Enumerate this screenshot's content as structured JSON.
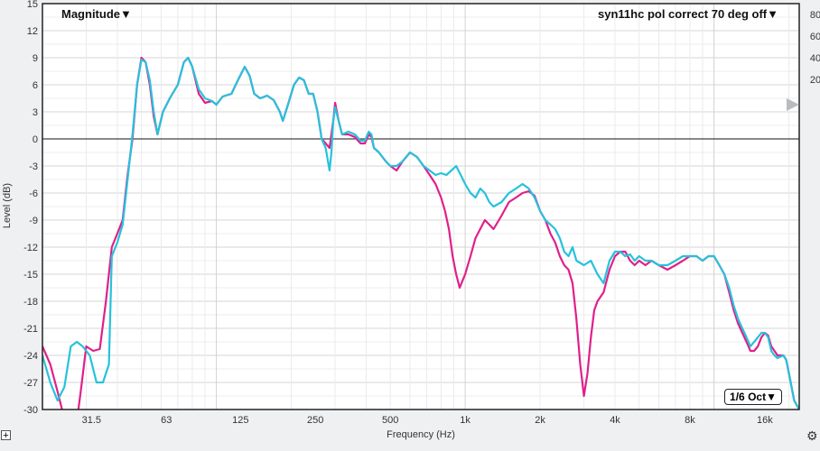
{
  "header": {
    "dropdown_label": "Magnitude▼",
    "title": "syn11hc pol correct 70 deg off▼"
  },
  "smoothing": {
    "label": "1/6 Oct▼"
  },
  "controls": {
    "expand_glyph": "+",
    "settings_glyph": "⚙"
  },
  "chart_data": {
    "type": "line",
    "title": "syn11hc pol correct 70 deg off",
    "xlabel": "Frequency (Hz)",
    "ylabel": "Level (dB)",
    "x_scale": "log",
    "xlim": [
      20,
      22000
    ],
    "ylim": [
      -30,
      15
    ],
    "grid": true,
    "x_ticks": [
      {
        "v": 31.5,
        "label": "31.5"
      },
      {
        "v": 63,
        "label": "63"
      },
      {
        "v": 125,
        "label": "125"
      },
      {
        "v": 250,
        "label": "250"
      },
      {
        "v": 500,
        "label": "500"
      },
      {
        "v": 1000,
        "label": "1k"
      },
      {
        "v": 2000,
        "label": "2k"
      },
      {
        "v": 4000,
        "label": "4k"
      },
      {
        "v": 8000,
        "label": "8k"
      },
      {
        "v": 16000,
        "label": "16k"
      }
    ],
    "y_ticks": [
      15,
      12,
      9,
      6,
      3,
      0,
      -3,
      -6,
      -9,
      -12,
      -15,
      -18,
      -21,
      -24,
      -27,
      -30
    ],
    "right_axis": {
      "ticks": [
        80,
        60,
        40,
        20
      ],
      "tick_levels_db": [
        13.8,
        11.4,
        9.0,
        6.6
      ]
    },
    "colors": {
      "magenta": "#e0208a",
      "cyan": "#26c2dc"
    },
    "series": [
      {
        "color": "magenta",
        "points": [
          [
            20,
            -23
          ],
          [
            21.5,
            -25
          ],
          [
            23,
            -28
          ],
          [
            25,
            -32
          ],
          [
            27,
            -34
          ],
          [
            28.5,
            -28
          ],
          [
            30,
            -23
          ],
          [
            32,
            -23.5
          ],
          [
            34,
            -23.3
          ],
          [
            36,
            -18
          ],
          [
            38,
            -12
          ],
          [
            40,
            -10.5
          ],
          [
            42,
            -9
          ],
          [
            44,
            -4
          ],
          [
            46,
            0
          ],
          [
            48,
            6
          ],
          [
            50,
            9
          ],
          [
            52,
            8.5
          ],
          [
            54,
            6
          ],
          [
            56,
            2.5
          ],
          [
            58,
            0.5
          ],
          [
            61,
            3
          ],
          [
            65,
            4.5
          ],
          [
            70,
            6
          ],
          [
            74,
            8.5
          ],
          [
            77,
            9
          ],
          [
            80,
            8
          ],
          [
            85,
            5
          ],
          [
            90,
            4
          ],
          [
            96,
            4.2
          ],
          [
            100,
            3.8
          ],
          [
            106,
            4.7
          ],
          [
            115,
            5
          ],
          [
            122,
            6.5
          ],
          [
            130,
            8
          ],
          [
            136,
            7
          ],
          [
            142,
            5
          ],
          [
            150,
            4.5
          ],
          [
            160,
            4.8
          ],
          [
            170,
            4.3
          ],
          [
            180,
            3
          ],
          [
            185,
            2
          ],
          [
            195,
            4
          ],
          [
            205,
            6
          ],
          [
            215,
            6.8
          ],
          [
            225,
            6.5
          ],
          [
            235,
            5
          ],
          [
            245,
            5
          ],
          [
            255,
            3
          ],
          [
            265,
            0
          ],
          [
            275,
            -0.5
          ],
          [
            285,
            -1
          ],
          [
            295,
            2
          ],
          [
            300,
            4
          ],
          [
            310,
            2
          ],
          [
            320,
            0.5
          ],
          [
            340,
            0.5
          ],
          [
            360,
            0.2
          ],
          [
            380,
            -0.5
          ],
          [
            395,
            -0.5
          ],
          [
            410,
            0.5
          ],
          [
            420,
            0.2
          ],
          [
            430,
            -1
          ],
          [
            450,
            -1.5
          ],
          [
            480,
            -2.5
          ],
          [
            500,
            -3
          ],
          [
            530,
            -3.5
          ],
          [
            560,
            -2.5
          ],
          [
            600,
            -1.5
          ],
          [
            640,
            -2
          ],
          [
            680,
            -3
          ],
          [
            720,
            -4
          ],
          [
            760,
            -5
          ],
          [
            800,
            -6.5
          ],
          [
            830,
            -8
          ],
          [
            860,
            -10
          ],
          [
            890,
            -13
          ],
          [
            920,
            -15
          ],
          [
            950,
            -16.5
          ],
          [
            1000,
            -15
          ],
          [
            1050,
            -13
          ],
          [
            1100,
            -11
          ],
          [
            1200,
            -9
          ],
          [
            1250,
            -9.5
          ],
          [
            1300,
            -10
          ],
          [
            1400,
            -8.5
          ],
          [
            1500,
            -7
          ],
          [
            1600,
            -6.5
          ],
          [
            1700,
            -6
          ],
          [
            1800,
            -5.8
          ],
          [
            1900,
            -6.3
          ],
          [
            2000,
            -8
          ],
          [
            2100,
            -9
          ],
          [
            2200,
            -10.5
          ],
          [
            2300,
            -11.5
          ],
          [
            2400,
            -13
          ],
          [
            2500,
            -14
          ],
          [
            2600,
            -14.5
          ],
          [
            2700,
            -16
          ],
          [
            2800,
            -20
          ],
          [
            2900,
            -25
          ],
          [
            3000,
            -28.5
          ],
          [
            3100,
            -26
          ],
          [
            3200,
            -22
          ],
          [
            3300,
            -19
          ],
          [
            3400,
            -18
          ],
          [
            3600,
            -17
          ],
          [
            3800,
            -14.5
          ],
          [
            4000,
            -13
          ],
          [
            4200,
            -12.5
          ],
          [
            4400,
            -12.5
          ],
          [
            4600,
            -13.5
          ],
          [
            4800,
            -14
          ],
          [
            5000,
            -13.5
          ],
          [
            5300,
            -14
          ],
          [
            5600,
            -13.5
          ],
          [
            6000,
            -14
          ],
          [
            6500,
            -14.5
          ],
          [
            7000,
            -14
          ],
          [
            7500,
            -13.5
          ],
          [
            8000,
            -13
          ],
          [
            8500,
            -13
          ],
          [
            9000,
            -13.5
          ],
          [
            9500,
            -13
          ],
          [
            10000,
            -13
          ],
          [
            10500,
            -14
          ],
          [
            11000,
            -15
          ],
          [
            11500,
            -17
          ],
          [
            12000,
            -19
          ],
          [
            12500,
            -20.5
          ],
          [
            13000,
            -21.5
          ],
          [
            13500,
            -22.5
          ],
          [
            14000,
            -23.5
          ],
          [
            14500,
            -23.5
          ],
          [
            15000,
            -23
          ],
          [
            15500,
            -22
          ],
          [
            16000,
            -21.5
          ],
          [
            16500,
            -21.8
          ],
          [
            17000,
            -23
          ],
          [
            17500,
            -23.5
          ],
          [
            18000,
            -24
          ],
          [
            19000,
            -24
          ],
          [
            19500,
            -24.5
          ],
          [
            20000,
            -26
          ],
          [
            21000,
            -29
          ],
          [
            22000,
            -30
          ]
        ]
      },
      {
        "color": "cyan",
        "points": [
          [
            20,
            -24
          ],
          [
            21.5,
            -27
          ],
          [
            23,
            -29
          ],
          [
            24.5,
            -27.5
          ],
          [
            26,
            -23
          ],
          [
            27.5,
            -22.5
          ],
          [
            29,
            -23
          ],
          [
            31,
            -24
          ],
          [
            33,
            -27
          ],
          [
            35,
            -27
          ],
          [
            37,
            -25
          ],
          [
            38,
            -13
          ],
          [
            40,
            -11.5
          ],
          [
            42,
            -9.5
          ],
          [
            44,
            -4.5
          ],
          [
            46,
            0.5
          ],
          [
            48,
            6
          ],
          [
            50,
            8.8
          ],
          [
            52,
            8.5
          ],
          [
            54,
            6.5
          ],
          [
            56,
            3
          ],
          [
            58,
            0.5
          ],
          [
            61,
            3
          ],
          [
            65,
            4.5
          ],
          [
            70,
            6
          ],
          [
            74,
            8.5
          ],
          [
            77,
            9
          ],
          [
            80,
            8
          ],
          [
            85,
            5.5
          ],
          [
            90,
            4.5
          ],
          [
            96,
            4.2
          ],
          [
            100,
            3.8
          ],
          [
            106,
            4.7
          ],
          [
            115,
            5
          ],
          [
            122,
            6.5
          ],
          [
            130,
            8
          ],
          [
            136,
            7
          ],
          [
            142,
            5
          ],
          [
            150,
            4.5
          ],
          [
            160,
            4.8
          ],
          [
            170,
            4.3
          ],
          [
            180,
            3
          ],
          [
            185,
            2
          ],
          [
            195,
            4
          ],
          [
            205,
            6
          ],
          [
            215,
            6.8
          ],
          [
            225,
            6.5
          ],
          [
            235,
            5
          ],
          [
            245,
            5
          ],
          [
            255,
            3
          ],
          [
            265,
            0
          ],
          [
            275,
            -1
          ],
          [
            285,
            -3.5
          ],
          [
            290,
            -1.5
          ],
          [
            295,
            2
          ],
          [
            300,
            3.5
          ],
          [
            310,
            2
          ],
          [
            320,
            0.5
          ],
          [
            340,
            0.8
          ],
          [
            360,
            0.5
          ],
          [
            380,
            -0.2
          ],
          [
            395,
            -0.2
          ],
          [
            410,
            0.8
          ],
          [
            420,
            0.5
          ],
          [
            430,
            -1
          ],
          [
            450,
            -1.5
          ],
          [
            480,
            -2.5
          ],
          [
            500,
            -3
          ],
          [
            530,
            -3
          ],
          [
            560,
            -2.5
          ],
          [
            600,
            -1.5
          ],
          [
            640,
            -2
          ],
          [
            680,
            -3
          ],
          [
            720,
            -3.5
          ],
          [
            760,
            -4
          ],
          [
            800,
            -3.8
          ],
          [
            840,
            -4
          ],
          [
            880,
            -3.5
          ],
          [
            920,
            -3
          ],
          [
            960,
            -4
          ],
          [
            1000,
            -5
          ],
          [
            1050,
            -6
          ],
          [
            1100,
            -6.5
          ],
          [
            1150,
            -5.5
          ],
          [
            1200,
            -6
          ],
          [
            1250,
            -7
          ],
          [
            1300,
            -7.5
          ],
          [
            1400,
            -7
          ],
          [
            1500,
            -6
          ],
          [
            1600,
            -5.5
          ],
          [
            1700,
            -5
          ],
          [
            1800,
            -5.5
          ],
          [
            1900,
            -6.5
          ],
          [
            2000,
            -8
          ],
          [
            2100,
            -9
          ],
          [
            2200,
            -9.5
          ],
          [
            2300,
            -10
          ],
          [
            2400,
            -11
          ],
          [
            2500,
            -12.5
          ],
          [
            2600,
            -13
          ],
          [
            2700,
            -12
          ],
          [
            2800,
            -13.5
          ],
          [
            3000,
            -14
          ],
          [
            3200,
            -13.5
          ],
          [
            3400,
            -15
          ],
          [
            3600,
            -16
          ],
          [
            3800,
            -13.5
          ],
          [
            4000,
            -12.5
          ],
          [
            4200,
            -12.5
          ],
          [
            4400,
            -13
          ],
          [
            4600,
            -12.8
          ],
          [
            4800,
            -13.5
          ],
          [
            5000,
            -13
          ],
          [
            5300,
            -13.5
          ],
          [
            5600,
            -13.5
          ],
          [
            6000,
            -14
          ],
          [
            6500,
            -14
          ],
          [
            7000,
            -13.5
          ],
          [
            7500,
            -13
          ],
          [
            8000,
            -13
          ],
          [
            8500,
            -13
          ],
          [
            9000,
            -13.5
          ],
          [
            9500,
            -13
          ],
          [
            10000,
            -13
          ],
          [
            10500,
            -14
          ],
          [
            11000,
            -15
          ],
          [
            11500,
            -16.5
          ],
          [
            12000,
            -18.5
          ],
          [
            12500,
            -20
          ],
          [
            13000,
            -21
          ],
          [
            13500,
            -22
          ],
          [
            14000,
            -23
          ],
          [
            14500,
            -22.5
          ],
          [
            15000,
            -22
          ],
          [
            15500,
            -21.5
          ],
          [
            16000,
            -21.5
          ],
          [
            16500,
            -22
          ],
          [
            17000,
            -23.5
          ],
          [
            17500,
            -24
          ],
          [
            18000,
            -24.3
          ],
          [
            19000,
            -24
          ],
          [
            19500,
            -24.5
          ],
          [
            20000,
            -26
          ],
          [
            21000,
            -29
          ],
          [
            22000,
            -30
          ]
        ]
      }
    ]
  }
}
